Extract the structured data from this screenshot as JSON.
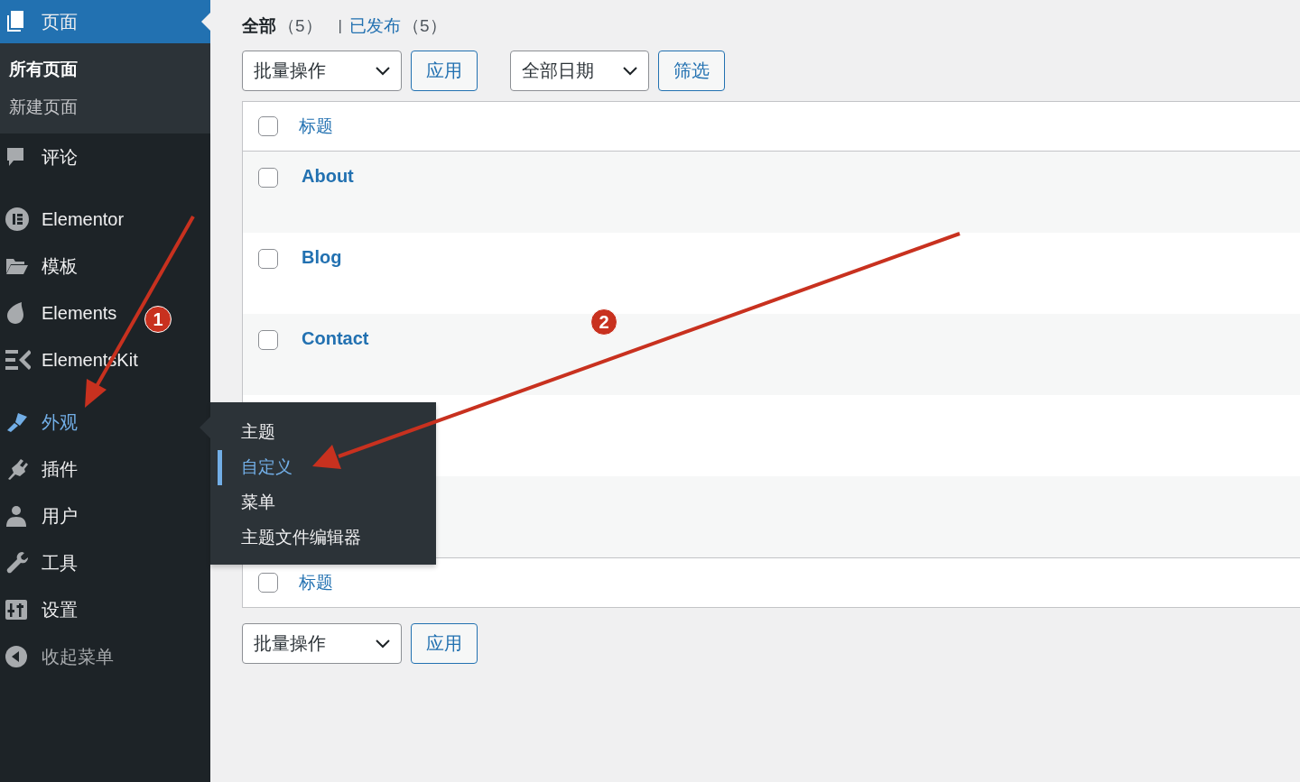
{
  "sidebar": {
    "items": [
      {
        "label": "页面",
        "selected": true,
        "expanded": false,
        "kind": "menu",
        "children": [
          {
            "label": "所有页面",
            "selected": true
          },
          {
            "label": "新建页面",
            "selected": false
          }
        ]
      },
      {
        "label": "评论",
        "selected": false,
        "expanded": false,
        "kind": "menu"
      },
      {
        "label": "Elementor",
        "selected": false,
        "expanded": false,
        "kind": "menu"
      },
      {
        "label": "模板",
        "selected": false,
        "expanded": false,
        "kind": "menu"
      },
      {
        "label": "Elements",
        "selected": false,
        "expanded": false,
        "kind": "menu"
      },
      {
        "label": "ElementsKit",
        "selected": false,
        "expanded": false,
        "kind": "menu"
      },
      {
        "label": "外观",
        "selected": false,
        "expanded": true,
        "kind": "menu",
        "flyout": [
          {
            "label": "主题",
            "selected": false
          },
          {
            "label": "自定义",
            "selected": true
          },
          {
            "label": "菜单",
            "selected": false
          },
          {
            "label": "主题文件编辑器",
            "selected": false
          }
        ]
      },
      {
        "label": "插件",
        "selected": false,
        "expanded": false,
        "kind": "menu"
      },
      {
        "label": "用户",
        "selected": false,
        "expanded": false,
        "kind": "menu"
      },
      {
        "label": "工具",
        "selected": false,
        "expanded": false,
        "kind": "menu"
      },
      {
        "label": "设置",
        "selected": false,
        "expanded": false,
        "kind": "menu"
      },
      {
        "label": "收起菜单",
        "selected": false,
        "expanded": false,
        "kind": "collapse"
      }
    ]
  },
  "views": [
    {
      "label": "全部",
      "count": "（5）",
      "selected": true
    },
    {
      "label": "已发布",
      "count": "（5）",
      "selected": false
    }
  ],
  "views_separator": "|",
  "top_toolbar": {
    "bulk_action": "批量操作",
    "apply": "应用",
    "date_filter": "全部日期",
    "filter": "筛选"
  },
  "table": {
    "header": {
      "checked": false,
      "title": "标题"
    },
    "rows": [
      {
        "title": "About",
        "checked": false
      },
      {
        "title": "Blog",
        "checked": false
      },
      {
        "title": "Contact",
        "checked": false
      }
    ],
    "footer": {
      "checked": false,
      "title": "标题"
    }
  },
  "bottom_toolbar": {
    "bulk_action": "批量操作",
    "apply": "应用"
  },
  "annotations": [
    {
      "label": "1"
    },
    {
      "label": "2"
    }
  ]
}
